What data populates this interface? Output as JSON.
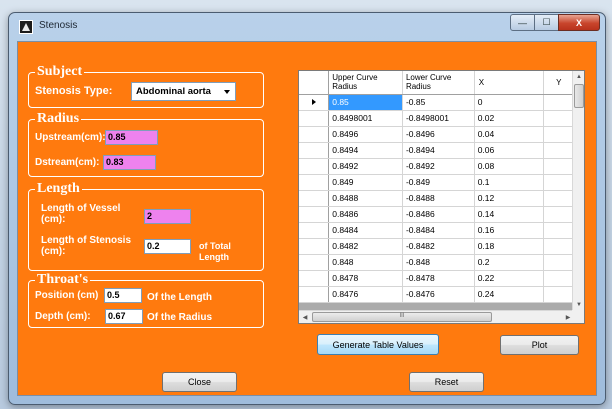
{
  "window": {
    "title": "Stenosis",
    "minimize_glyph": "—",
    "maximize_glyph": "☐",
    "close_glyph": "X"
  },
  "subject": {
    "group_title": "Subject",
    "stenosis_type_label": "Stenosis Type:",
    "stenosis_type_value": "Abdominal aorta"
  },
  "radius": {
    "group_title": "Radius",
    "upstream_label": "Upstream(cm):",
    "upstream_value": "0.85",
    "dstream_label": "Dstream(cm):",
    "dstream_value": "0.83"
  },
  "length": {
    "group_title": "Length",
    "vessel_label_line1": "Length of Vessel",
    "vessel_label_line2": "(cm):",
    "vessel_value": "2",
    "stenosis_label_line1": "Length of Stenosis",
    "stenosis_label_line2": "(cm):",
    "stenosis_value": "0.2",
    "stenosis_suffix": "of Total Length"
  },
  "throat": {
    "group_title": "Throat's",
    "position_label": "Position (cm)",
    "position_value": "0.5",
    "position_suffix": "Of the Length",
    "depth_label": "Depth (cm):",
    "depth_value": "0.67",
    "depth_suffix": "Of the Radius"
  },
  "grid": {
    "columns": [
      "Upper Curve Radius",
      "Lower Curve Radius",
      "X",
      "Y"
    ],
    "rows": [
      [
        "0.85",
        "-0.85",
        "0",
        ""
      ],
      [
        "0.8498001",
        "-0.8498001",
        "0.02",
        ""
      ],
      [
        "0.8496",
        "-0.8496",
        "0.04",
        ""
      ],
      [
        "0.8494",
        "-0.8494",
        "0.06",
        ""
      ],
      [
        "0.8492",
        "-0.8492",
        "0.08",
        ""
      ],
      [
        "0.849",
        "-0.849",
        "0.1",
        ""
      ],
      [
        "0.8488",
        "-0.8488",
        "0.12",
        ""
      ],
      [
        "0.8486",
        "-0.8486",
        "0.14",
        ""
      ],
      [
        "0.8484",
        "-0.8484",
        "0.16",
        ""
      ],
      [
        "0.8482",
        "-0.8482",
        "0.18",
        ""
      ],
      [
        "0.848",
        "-0.848",
        "0.2",
        ""
      ],
      [
        "0.8478",
        "-0.8478",
        "0.22",
        ""
      ],
      [
        "0.8476",
        "-0.8476",
        "0.24",
        ""
      ]
    ],
    "selected_row": 0,
    "scroll_grip": "III"
  },
  "buttons": {
    "generate": "Generate Table Values",
    "plot": "Plot",
    "close": "Close",
    "reset": "Reset"
  }
}
